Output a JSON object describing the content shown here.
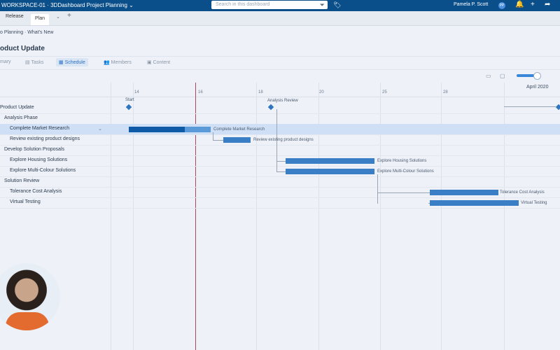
{
  "topbar": {
    "title": "WORKSPACE-01 · 3DDashboard  Project Planning ⌄",
    "search_placeholder": "Search in this dashboard",
    "user": "Pamela P. Scott",
    "avatar_initials": "PP"
  },
  "tabs": [
    "Release",
    "Plan"
  ],
  "breadcrumb": "o Planning · What's New",
  "page_title": "oduct Update",
  "subtabs": [
    "mary",
    "Tasks",
    "Schedule",
    "Members",
    "Content"
  ],
  "timeline": {
    "month": "April 2020",
    "weeks": [
      "14",
      "16",
      "18",
      "20",
      "25",
      "28"
    ]
  },
  "rows": [
    "Product Update",
    "Analysis Phase",
    "Complete Market Research",
    "Review existing product designs",
    "Develop Solution Proposals",
    "Explore Housing Solutions",
    "Explore Multi-Colour Solutions",
    "Solution Review",
    "Tolerance Cost Analysis",
    "Virtual Testing"
  ],
  "bars": [
    {
      "label": "Complete Market Research"
    },
    {
      "label": "Review existing product designs"
    },
    {
      "label": "Explore Housing Solutions"
    },
    {
      "label": "Explore Multi-Colour Solutions"
    },
    {
      "label": "Tolerance Cost Analysis"
    },
    {
      "label": "Virtual Testing"
    }
  ],
  "milestones": {
    "start": "Start",
    "analysis_review": "Analysis Review"
  }
}
